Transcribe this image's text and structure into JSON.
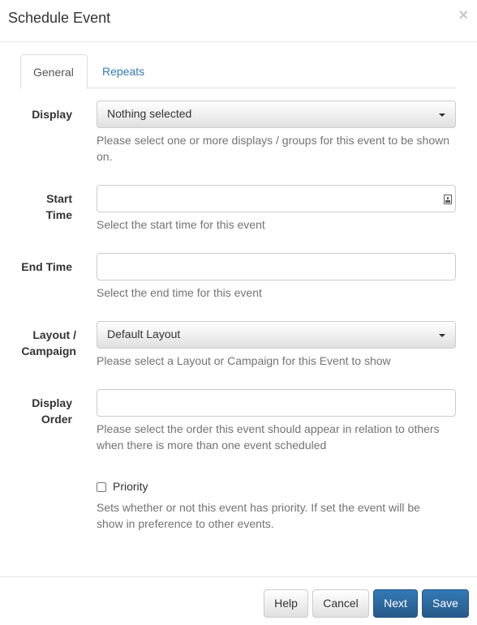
{
  "dialog": {
    "title": "Schedule Event",
    "close_glyph": "×"
  },
  "tabs": [
    {
      "label": "General",
      "active": true
    },
    {
      "label": "Repeats",
      "active": false
    }
  ],
  "fields": {
    "display": {
      "label": "Display",
      "selected": "Nothing selected",
      "help": "Please select one or more displays / groups for this event to be shown on."
    },
    "start_time": {
      "label_line1": "Start",
      "label_line2": "Time",
      "value": "",
      "help": "Select the start time for this event"
    },
    "end_time": {
      "label": "End Time",
      "value": "",
      "help": "Select the end time for this event"
    },
    "layout_campaign": {
      "label_line1": "Layout /",
      "label_line2": "Campaign",
      "selected": "Default Layout",
      "help": "Please select a Layout or Campaign for this Event to show"
    },
    "display_order": {
      "label_line1": "Display",
      "label_line2": "Order",
      "value": "",
      "help_line1": "Please select the order this event should appear in relation to others",
      "help_line2": "when there is more than one event scheduled"
    },
    "priority": {
      "label": "Priority",
      "checked": false,
      "help_line1": "Sets whether or not this event has priority. If set the event will be",
      "help_line2": "show in preference to other events."
    }
  },
  "footer": {
    "help_label": "Help",
    "cancel_label": "Cancel",
    "next_label": "Next",
    "save_label": "Save"
  },
  "colors": {
    "primary": "#337ab7",
    "link": "#337ab7",
    "help_text": "#737373"
  }
}
